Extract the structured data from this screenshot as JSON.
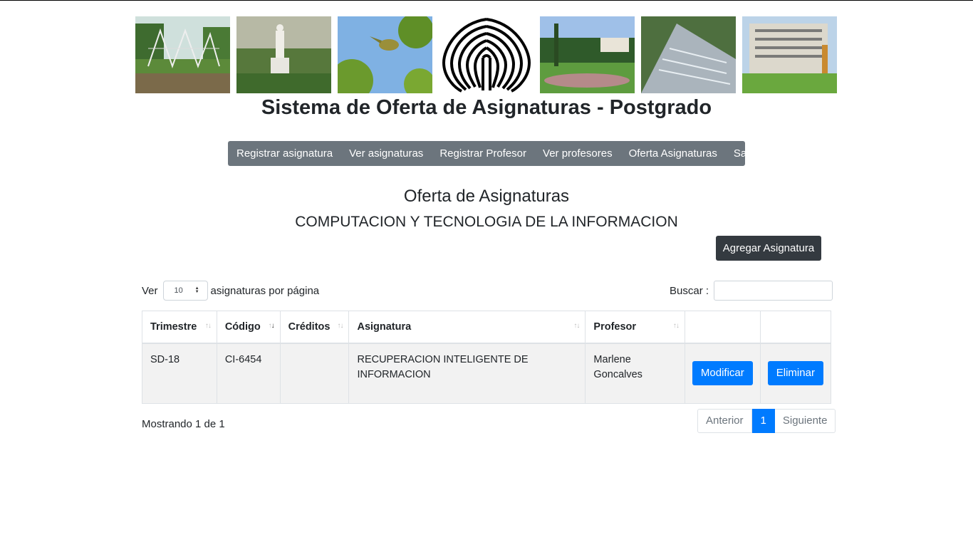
{
  "site_title": "Sistema de Oferta de Asignaturas - Postgrado",
  "nav": [
    {
      "label": "Registrar asignatura"
    },
    {
      "label": "Ver asignaturas"
    },
    {
      "label": "Registrar Profesor"
    },
    {
      "label": "Ver profesores"
    },
    {
      "label": "Oferta Asignaturas"
    },
    {
      "label": "Salir"
    }
  ],
  "page_heading": "Oferta de Asignaturas",
  "department": "COMPUTACION Y TECNOLOGIA DE LA INFORMACION",
  "add_button": "Agregar Asignatura",
  "length_menu": {
    "prefix": "Ver",
    "value": "10",
    "suffix": "asignaturas por página"
  },
  "search": {
    "label": "Buscar :",
    "value": ""
  },
  "table": {
    "columns": [
      "Trimestre",
      "Código",
      "Créditos",
      "Asignatura",
      "Profesor",
      "",
      ""
    ],
    "rows": [
      {
        "trimestre": "SD-18",
        "codigo": "CI-6454",
        "creditos": "",
        "asignatura": "RECUPERACION INTELIGENTE DE INFORMACION",
        "profesor": "Marlene Goncalves",
        "edit_label": "Modificar",
        "delete_label": "Eliminar"
      }
    ]
  },
  "info": "Mostrando 1 de 1",
  "pagination": {
    "previous": "Anterior",
    "current": "1",
    "next": "Siguiente"
  },
  "colors": {
    "navbar": "#6c757d",
    "primary": "#007bff",
    "dark": "#343a40"
  }
}
